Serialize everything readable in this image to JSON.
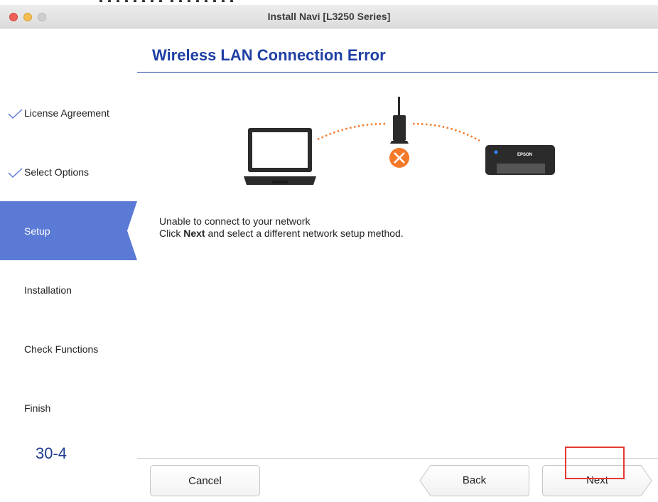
{
  "window": {
    "title": "Install Navi [L3250 Series]"
  },
  "sidebar": {
    "steps": [
      {
        "label": "License Agreement",
        "state": "completed"
      },
      {
        "label": "Select Options",
        "state": "completed"
      },
      {
        "label": "Setup",
        "state": "current"
      },
      {
        "label": "Installation",
        "state": "pending"
      },
      {
        "label": "Check Functions",
        "state": "pending"
      },
      {
        "label": "Finish",
        "state": "pending"
      }
    ],
    "page_number": "30-4"
  },
  "main": {
    "heading": "Wireless LAN Connection Error",
    "illustration": {
      "printer_brand": "EPSON",
      "status_icon": "error-x-icon"
    },
    "message": {
      "line1": "Unable to connect to your network",
      "line2_prefix": "Click ",
      "line2_bold": "Next",
      "line2_suffix": " and select a different network setup method."
    }
  },
  "footer": {
    "cancel_label": "Cancel",
    "back_label": "Back",
    "next_label": "Next"
  },
  "colors": {
    "accent": "#1f3fa3",
    "sidebar_active": "#5b7ad6",
    "error": "#f47a2a",
    "highlight_box": "#e53935"
  }
}
